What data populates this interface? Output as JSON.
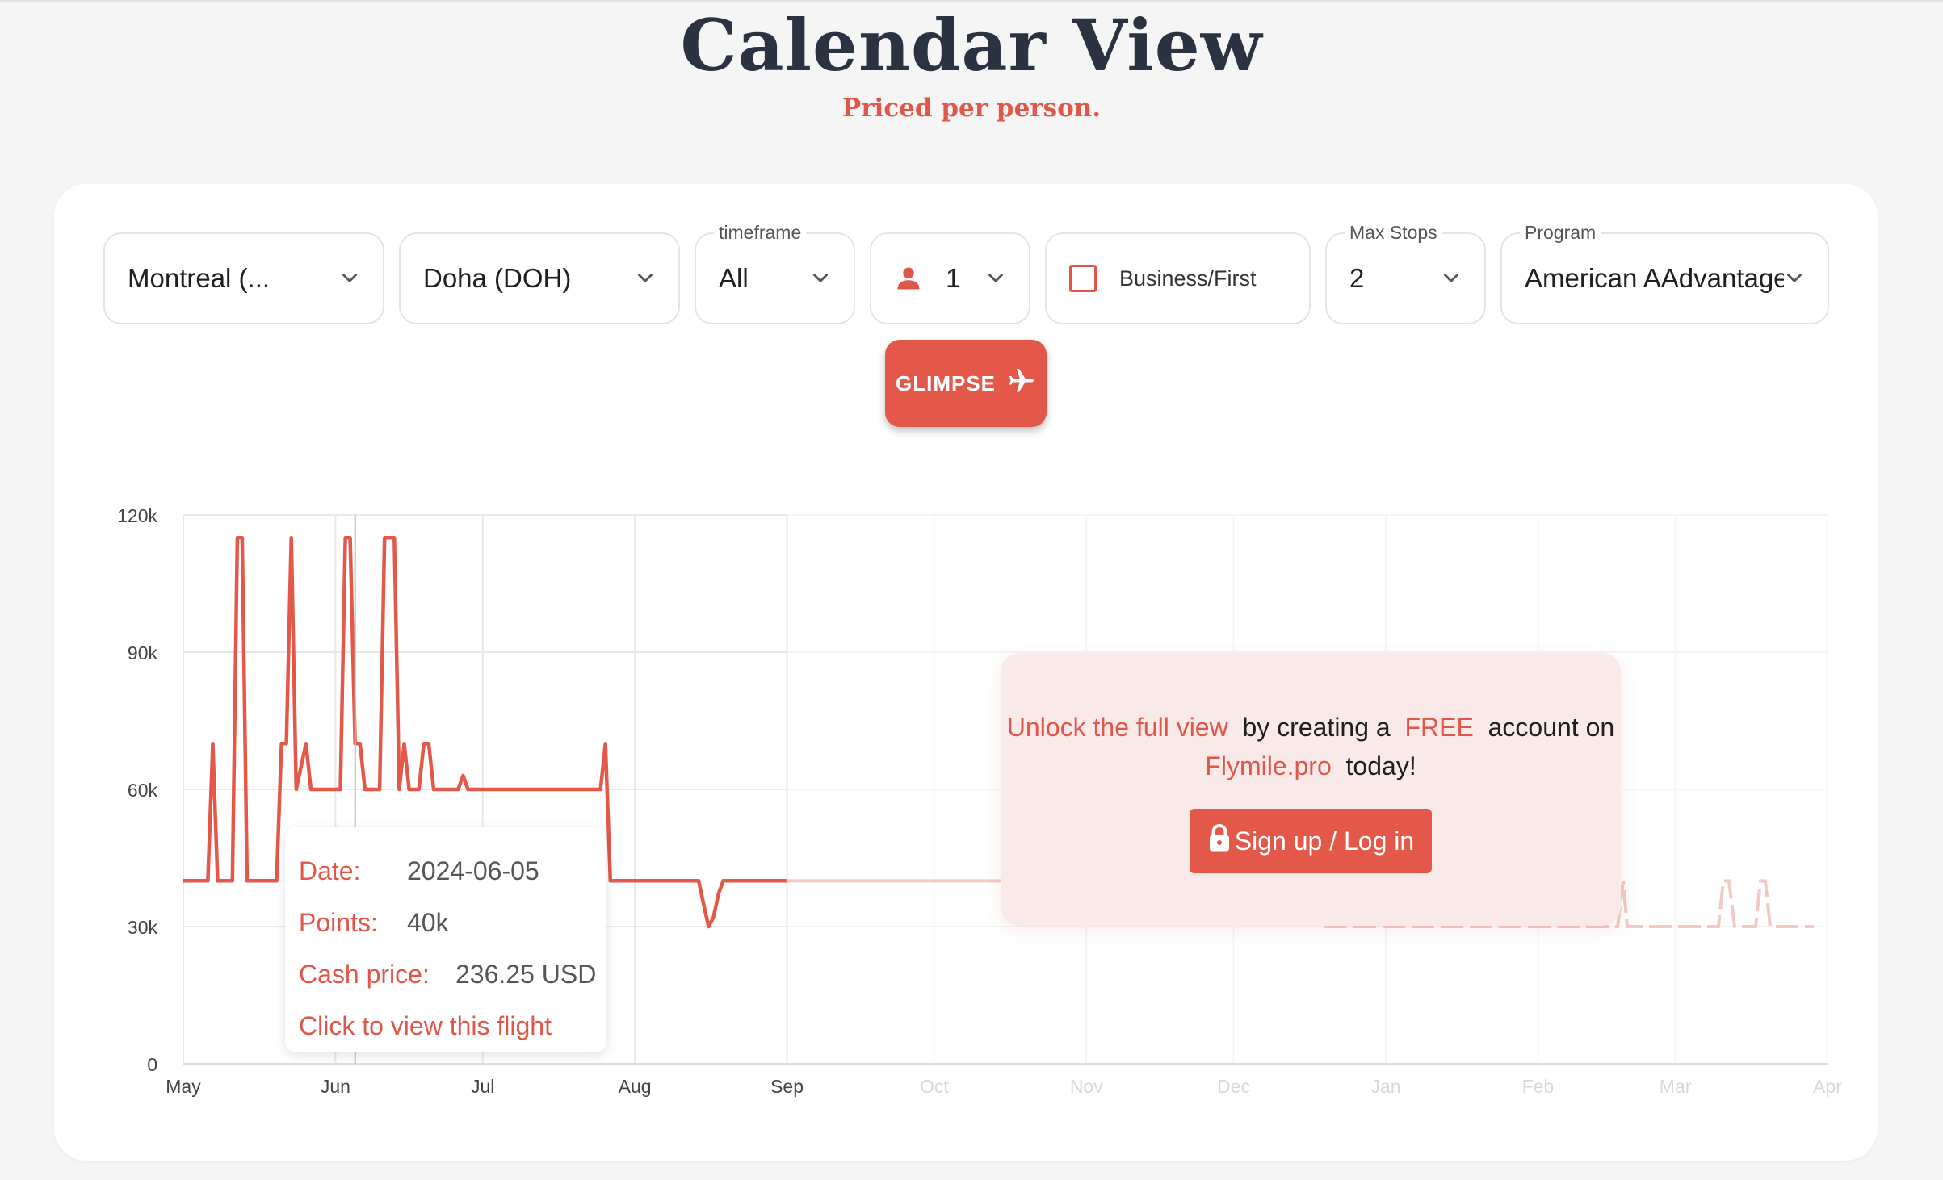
{
  "page": {
    "title": "Calendar View",
    "subtitle": "Priced per person."
  },
  "filters": {
    "origin": {
      "value": "Montreal (..."
    },
    "destination": {
      "value": "Doha (DOH)"
    },
    "timeframe": {
      "label": "timeframe",
      "value": "All"
    },
    "passengers": {
      "value": "1",
      "icon": "person-icon"
    },
    "cabin": {
      "label": "Business/First",
      "checked": false
    },
    "max_stops": {
      "label": "Max Stops",
      "value": "2"
    },
    "program": {
      "label": "Program",
      "value": "American AAdvantage"
    },
    "search_button": {
      "label": "GLIMPSE",
      "icon": "airplane-icon"
    }
  },
  "colors": {
    "accent": "#e4584a",
    "title": "#2b3242",
    "overlay": "#f9e8e7"
  },
  "tooltip": {
    "date_label": "Date:",
    "date_value": "2024-06-05",
    "points_label": "Points:",
    "points_value": "40k",
    "cash_label": "Cash price:",
    "cash_value": "236.25 USD",
    "link": "Click to view this flight"
  },
  "unlock": {
    "part1": "Unlock the full view",
    "part2": "by creating a",
    "part3": "FREE",
    "part4": "account on",
    "part5": "Flymile.pro",
    "part6": "today!",
    "button": "Sign up / Log in",
    "button_icon": "lock-icon"
  },
  "chart_data": {
    "type": "line",
    "title": "",
    "xlabel": "",
    "ylabel": "",
    "x_ticks": [
      "May",
      "Jun",
      "Jul",
      "Aug",
      "Sep",
      "Oct",
      "Nov",
      "Dec",
      "Jan",
      "Feb",
      "Mar",
      "Apr"
    ],
    "x_tick_dates": [
      "2024-05-01",
      "2024-06-01",
      "2024-07-01",
      "2024-08-01",
      "2024-09-01",
      "2024-10-01",
      "2024-11-01",
      "2024-12-01",
      "2025-01-01",
      "2025-02-01",
      "2025-03-01",
      "2025-04-01"
    ],
    "y_ticks": [
      "0",
      "30k",
      "60k",
      "90k",
      "120k"
    ],
    "ylim": [
      0,
      120000
    ],
    "xlim": [
      "2024-05-01",
      "2025-04-01"
    ],
    "grid": true,
    "highlight": {
      "date": "2024-06-05",
      "points": 40000
    },
    "series": [
      {
        "points": [
          [
            "2024-05-01",
            40000
          ],
          [
            "2024-05-06",
            40000
          ],
          [
            "2024-05-07",
            70000
          ],
          [
            "2024-05-08",
            40000
          ],
          [
            "2024-05-11",
            40000
          ],
          [
            "2024-05-12",
            115000
          ],
          [
            "2024-05-13",
            115000
          ],
          [
            "2024-05-14",
            40000
          ],
          [
            "2024-05-20",
            40000
          ],
          [
            "2024-05-21",
            70000
          ],
          [
            "2024-05-22",
            70000
          ],
          [
            "2024-05-23",
            115000
          ],
          [
            "2024-05-24",
            60000
          ],
          [
            "2024-05-26",
            70000
          ],
          [
            "2024-05-27",
            60000
          ],
          [
            "2024-05-29",
            60000
          ],
          [
            "2024-06-02",
            60000
          ],
          [
            "2024-06-03",
            115000
          ],
          [
            "2024-06-04",
            115000
          ],
          [
            "2024-06-05",
            70000
          ],
          [
            "2024-06-06",
            70000
          ],
          [
            "2024-06-07",
            60000
          ],
          [
            "2024-06-08",
            60000
          ],
          [
            "2024-06-10",
            60000
          ],
          [
            "2024-06-11",
            115000
          ],
          [
            "2024-06-12",
            115000
          ],
          [
            "2024-06-13",
            115000
          ],
          [
            "2024-06-14",
            60000
          ],
          [
            "2024-06-15",
            70000
          ],
          [
            "2024-06-16",
            60000
          ],
          [
            "2024-06-18",
            60000
          ],
          [
            "2024-06-19",
            70000
          ],
          [
            "2024-06-20",
            70000
          ],
          [
            "2024-06-21",
            60000
          ],
          [
            "2024-06-26",
            60000
          ],
          [
            "2024-06-27",
            63000
          ],
          [
            "2024-06-28",
            60000
          ],
          [
            "2024-07-25",
            60000
          ],
          [
            "2024-07-26",
            70000
          ],
          [
            "2024-07-27",
            40000
          ],
          [
            "2024-08-14",
            40000
          ],
          [
            "2024-08-15",
            35000
          ],
          [
            "2024-08-16",
            30000
          ],
          [
            "2024-08-17",
            32000
          ],
          [
            "2024-08-18",
            37000
          ],
          [
            "2024-08-19",
            40000
          ],
          [
            "2024-09-01",
            40000
          ]
        ]
      }
    ]
  }
}
